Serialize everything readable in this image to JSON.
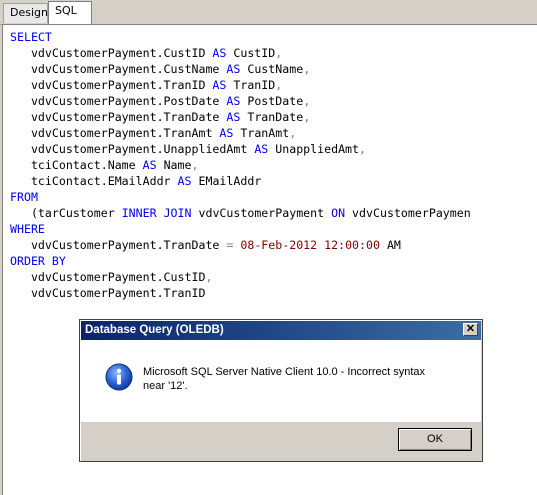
{
  "tabs": [
    {
      "label": "Design"
    },
    {
      "label": "SQL"
    }
  ],
  "sql": {
    "lines": [
      [
        {
          "t": "SELECT",
          "c": "kw"
        }
      ],
      [
        {
          "t": "   vdvCustomerPayment.CustID "
        },
        {
          "t": "AS",
          "c": "kw"
        },
        {
          "t": " CustID"
        },
        {
          "t": ",",
          "c": "op"
        }
      ],
      [
        {
          "t": "   vdvCustomerPayment.CustName "
        },
        {
          "t": "AS",
          "c": "kw"
        },
        {
          "t": " CustName"
        },
        {
          "t": ",",
          "c": "op"
        }
      ],
      [
        {
          "t": "   vdvCustomerPayment.TranID "
        },
        {
          "t": "AS",
          "c": "kw"
        },
        {
          "t": " TranID"
        },
        {
          "t": ",",
          "c": "op"
        }
      ],
      [
        {
          "t": "   vdvCustomerPayment.PostDate "
        },
        {
          "t": "AS",
          "c": "kw"
        },
        {
          "t": " PostDate"
        },
        {
          "t": ",",
          "c": "op"
        }
      ],
      [
        {
          "t": "   vdvCustomerPayment.TranDate "
        },
        {
          "t": "AS",
          "c": "kw"
        },
        {
          "t": " TranDate"
        },
        {
          "t": ",",
          "c": "op"
        }
      ],
      [
        {
          "t": "   vdvCustomerPayment.TranAmt "
        },
        {
          "t": "AS",
          "c": "kw"
        },
        {
          "t": " TranAmt"
        },
        {
          "t": ",",
          "c": "op"
        }
      ],
      [
        {
          "t": "   vdvCustomerPayment.UnappliedAmt "
        },
        {
          "t": "AS",
          "c": "kw"
        },
        {
          "t": " UnappliedAmt"
        },
        {
          "t": ",",
          "c": "op"
        }
      ],
      [
        {
          "t": "   tciContact.Name "
        },
        {
          "t": "AS",
          "c": "kw"
        },
        {
          "t": " Name"
        },
        {
          "t": ",",
          "c": "op"
        }
      ],
      [
        {
          "t": "   tciContact.EMailAddr "
        },
        {
          "t": "AS",
          "c": "kw"
        },
        {
          "t": " EMailAddr"
        }
      ],
      [
        {
          "t": "FROM",
          "c": "kw"
        }
      ],
      [
        {
          "t": "   (tarCustomer "
        },
        {
          "t": "INNER JOIN",
          "c": "kw"
        },
        {
          "t": " vdvCustomerPayment "
        },
        {
          "t": "ON",
          "c": "kw"
        },
        {
          "t": " vdvCustomerPaymen"
        }
      ],
      [
        {
          "t": "WHERE",
          "c": "kw"
        }
      ],
      [
        {
          "t": "   vdvCustomerPayment.TranDate "
        },
        {
          "t": "=",
          "c": "op"
        },
        {
          "t": " "
        },
        {
          "t": "08-Feb-2012",
          "c": "lit"
        },
        {
          "t": " "
        },
        {
          "t": "12:00:00",
          "c": "lit"
        },
        {
          "t": " AM"
        }
      ],
      [
        {
          "t": "ORDER BY",
          "c": "kw"
        }
      ],
      [
        {
          "t": "   vdvCustomerPayment.CustID"
        },
        {
          "t": ",",
          "c": "op"
        }
      ],
      [
        {
          "t": "   vdvCustomerPayment.TranID"
        }
      ]
    ]
  },
  "dialog": {
    "title": "Database Query (OLEDB)",
    "close_label": "✕",
    "icon": "info-icon",
    "message": "Microsoft SQL Server Native Client 10.0 - Incorrect syntax near '12'.",
    "ok_label": "OK"
  },
  "colors": {
    "keyword": "#0000ff",
    "operator": "#808080",
    "literal": "#800000"
  }
}
